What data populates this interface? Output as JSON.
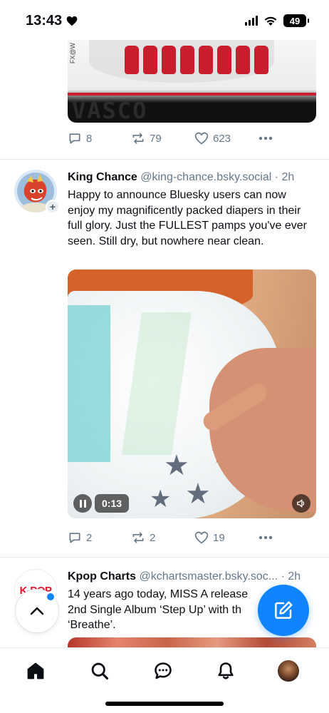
{
  "status_bar": {
    "time": "13:43",
    "battery": "49",
    "icons": [
      "heart-icon",
      "cellular-signal-icon",
      "wifi-icon",
      "battery-icon"
    ]
  },
  "previous_post": {
    "image_text": "VASCO",
    "image_corner_text": "FX@W",
    "stats": {
      "replies": "8",
      "reposts": "79",
      "likes": "623"
    }
  },
  "posts": [
    {
      "display_name": "King Chance",
      "handle": "@king-chance.bsky.social",
      "separator": "·",
      "time": "2h",
      "text": "Happy to announce Bluesky users can now enjoy my magnificently packed diapers in their full glory. Just the FULLEST pamps you've ever seen. Still dry, but nowhere near clean.",
      "video": {
        "elapsed": "0:13",
        "state": "playing"
      },
      "stats": {
        "replies": "2",
        "reposts": "2",
        "likes": "19"
      }
    },
    {
      "display_name": "Kpop Charts",
      "handle": "@kchartsmaster.bsky.soc...",
      "separator": "·",
      "time": "2h",
      "avatar_text": "K-POP",
      "text_lines": [
        "14 years ago today, MISS A release",
        "2nd Single Album ‘Step Up’ with th",
        "‘Breathe’."
      ]
    }
  ],
  "bottom_nav": {
    "items": [
      "home-icon",
      "search-icon",
      "chat-icon",
      "notifications-icon",
      "profile-avatar"
    ],
    "active": "home-icon"
  },
  "colors": {
    "accent": "#1083fe",
    "muted_text": "#66788a",
    "text": "#0b0f14",
    "divider": "#e6eaee"
  }
}
